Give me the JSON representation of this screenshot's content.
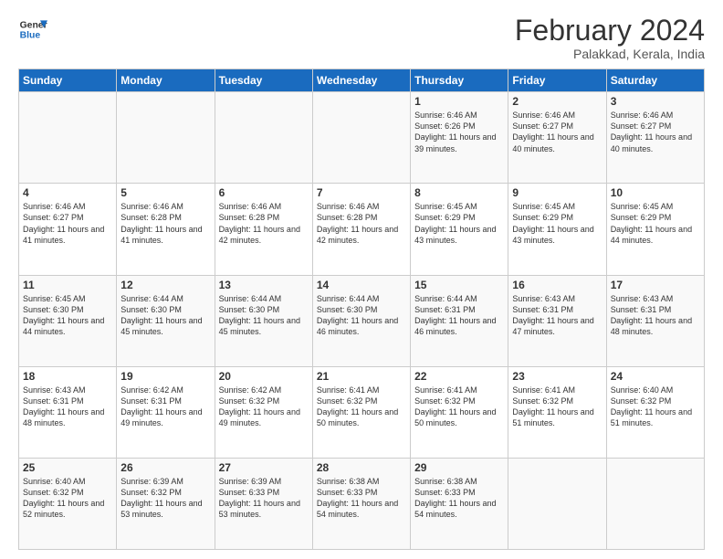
{
  "logo": {
    "line1": "General",
    "line2": "Blue"
  },
  "title": "February 2024",
  "subtitle": "Palakkad, Kerala, India",
  "header_days": [
    "Sunday",
    "Monday",
    "Tuesday",
    "Wednesday",
    "Thursday",
    "Friday",
    "Saturday"
  ],
  "weeks": [
    [
      {
        "day": "",
        "info": ""
      },
      {
        "day": "",
        "info": ""
      },
      {
        "day": "",
        "info": ""
      },
      {
        "day": "",
        "info": ""
      },
      {
        "day": "1",
        "info": "Sunrise: 6:46 AM\nSunset: 6:26 PM\nDaylight: 11 hours and 39 minutes."
      },
      {
        "day": "2",
        "info": "Sunrise: 6:46 AM\nSunset: 6:27 PM\nDaylight: 11 hours and 40 minutes."
      },
      {
        "day": "3",
        "info": "Sunrise: 6:46 AM\nSunset: 6:27 PM\nDaylight: 11 hours and 40 minutes."
      }
    ],
    [
      {
        "day": "4",
        "info": "Sunrise: 6:46 AM\nSunset: 6:27 PM\nDaylight: 11 hours and 41 minutes."
      },
      {
        "day": "5",
        "info": "Sunrise: 6:46 AM\nSunset: 6:28 PM\nDaylight: 11 hours and 41 minutes."
      },
      {
        "day": "6",
        "info": "Sunrise: 6:46 AM\nSunset: 6:28 PM\nDaylight: 11 hours and 42 minutes."
      },
      {
        "day": "7",
        "info": "Sunrise: 6:46 AM\nSunset: 6:28 PM\nDaylight: 11 hours and 42 minutes."
      },
      {
        "day": "8",
        "info": "Sunrise: 6:45 AM\nSunset: 6:29 PM\nDaylight: 11 hours and 43 minutes."
      },
      {
        "day": "9",
        "info": "Sunrise: 6:45 AM\nSunset: 6:29 PM\nDaylight: 11 hours and 43 minutes."
      },
      {
        "day": "10",
        "info": "Sunrise: 6:45 AM\nSunset: 6:29 PM\nDaylight: 11 hours and 44 minutes."
      }
    ],
    [
      {
        "day": "11",
        "info": "Sunrise: 6:45 AM\nSunset: 6:30 PM\nDaylight: 11 hours and 44 minutes."
      },
      {
        "day": "12",
        "info": "Sunrise: 6:44 AM\nSunset: 6:30 PM\nDaylight: 11 hours and 45 minutes."
      },
      {
        "day": "13",
        "info": "Sunrise: 6:44 AM\nSunset: 6:30 PM\nDaylight: 11 hours and 45 minutes."
      },
      {
        "day": "14",
        "info": "Sunrise: 6:44 AM\nSunset: 6:30 PM\nDaylight: 11 hours and 46 minutes."
      },
      {
        "day": "15",
        "info": "Sunrise: 6:44 AM\nSunset: 6:31 PM\nDaylight: 11 hours and 46 minutes."
      },
      {
        "day": "16",
        "info": "Sunrise: 6:43 AM\nSunset: 6:31 PM\nDaylight: 11 hours and 47 minutes."
      },
      {
        "day": "17",
        "info": "Sunrise: 6:43 AM\nSunset: 6:31 PM\nDaylight: 11 hours and 48 minutes."
      }
    ],
    [
      {
        "day": "18",
        "info": "Sunrise: 6:43 AM\nSunset: 6:31 PM\nDaylight: 11 hours and 48 minutes."
      },
      {
        "day": "19",
        "info": "Sunrise: 6:42 AM\nSunset: 6:31 PM\nDaylight: 11 hours and 49 minutes."
      },
      {
        "day": "20",
        "info": "Sunrise: 6:42 AM\nSunset: 6:32 PM\nDaylight: 11 hours and 49 minutes."
      },
      {
        "day": "21",
        "info": "Sunrise: 6:41 AM\nSunset: 6:32 PM\nDaylight: 11 hours and 50 minutes."
      },
      {
        "day": "22",
        "info": "Sunrise: 6:41 AM\nSunset: 6:32 PM\nDaylight: 11 hours and 50 minutes."
      },
      {
        "day": "23",
        "info": "Sunrise: 6:41 AM\nSunset: 6:32 PM\nDaylight: 11 hours and 51 minutes."
      },
      {
        "day": "24",
        "info": "Sunrise: 6:40 AM\nSunset: 6:32 PM\nDaylight: 11 hours and 51 minutes."
      }
    ],
    [
      {
        "day": "25",
        "info": "Sunrise: 6:40 AM\nSunset: 6:32 PM\nDaylight: 11 hours and 52 minutes."
      },
      {
        "day": "26",
        "info": "Sunrise: 6:39 AM\nSunset: 6:32 PM\nDaylight: 11 hours and 53 minutes."
      },
      {
        "day": "27",
        "info": "Sunrise: 6:39 AM\nSunset: 6:33 PM\nDaylight: 11 hours and 53 minutes."
      },
      {
        "day": "28",
        "info": "Sunrise: 6:38 AM\nSunset: 6:33 PM\nDaylight: 11 hours and 54 minutes."
      },
      {
        "day": "29",
        "info": "Sunrise: 6:38 AM\nSunset: 6:33 PM\nDaylight: 11 hours and 54 minutes."
      },
      {
        "day": "",
        "info": ""
      },
      {
        "day": "",
        "info": ""
      }
    ]
  ]
}
